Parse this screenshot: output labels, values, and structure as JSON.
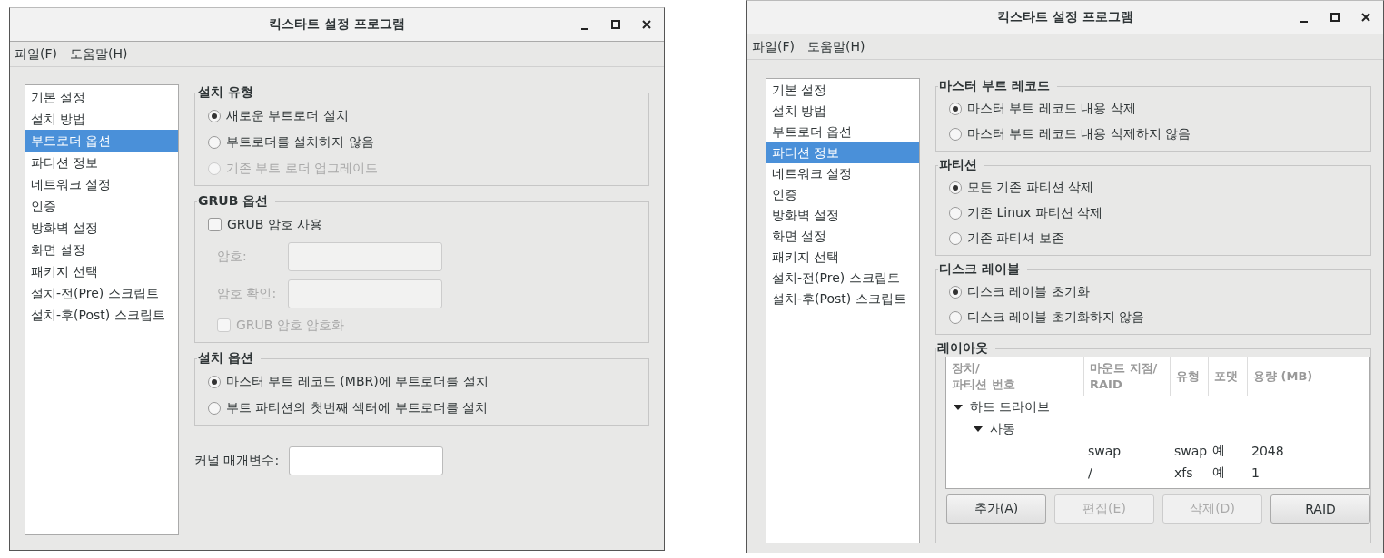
{
  "windows": [
    {
      "title": "킥스타트 설정 프로그램",
      "menu": [
        "파일(F)",
        "도움말(H)"
      ],
      "sidebar": [
        {
          "label": "기본 설정",
          "selected": false
        },
        {
          "label": "설치 방법",
          "selected": false
        },
        {
          "label": "부트로더 옵션",
          "selected": true
        },
        {
          "label": "파티션 정보",
          "selected": false
        },
        {
          "label": "네트워크 설정",
          "selected": false
        },
        {
          "label": "인증",
          "selected": false
        },
        {
          "label": "방화벽 설정",
          "selected": false
        },
        {
          "label": "화면 설정",
          "selected": false
        },
        {
          "label": "패키지 선택",
          "selected": false
        },
        {
          "label": "설치-전(Pre) 스크립트",
          "selected": false
        },
        {
          "label": "설치-후(Post) 스크립트",
          "selected": false
        }
      ],
      "sections": [
        {
          "kind": "group",
          "title": "설치 유형",
          "items": [
            {
              "kind": "radio",
              "label": "새로운 부트로더 설치",
              "selected": true,
              "disabled": false
            },
            {
              "kind": "radio",
              "label": "부트로더를 설치하지 않음",
              "selected": false,
              "disabled": false
            },
            {
              "kind": "radio",
              "label": "기존 부트 로더 업그레이드",
              "selected": false,
              "disabled": true
            }
          ]
        },
        {
          "kind": "group",
          "title": "GRUB 옵션",
          "items": [
            {
              "kind": "checkbox",
              "label": "GRUB 암호 사용",
              "checked": false,
              "disabled": false
            },
            {
              "kind": "field",
              "label": "암호:",
              "disabled": true
            },
            {
              "kind": "field",
              "label": "암호 확인:",
              "disabled": true
            },
            {
              "kind": "checkbox",
              "label": "GRUB 암호 암호화",
              "checked": false,
              "disabled": true
            }
          ]
        },
        {
          "kind": "group",
          "title": "설치 옵션",
          "items": [
            {
              "kind": "radio",
              "label": "마스터 부트 레코드 (MBR)에 부트로더를 설치",
              "selected": true,
              "disabled": false
            },
            {
              "kind": "radio",
              "label": "부트 파티션의 첫번째 섹터에 부트로더를 설치",
              "selected": false,
              "disabled": false
            }
          ]
        },
        {
          "kind": "plain",
          "items": [
            {
              "kind": "field",
              "label": "커널 매개변수:",
              "disabled": false
            }
          ]
        }
      ]
    },
    {
      "title": "킥스타트 설정 프로그램",
      "menu": [
        "파일(F)",
        "도움말(H)"
      ],
      "sidebar": [
        {
          "label": "기본 설정",
          "selected": false
        },
        {
          "label": "설치 방법",
          "selected": false
        },
        {
          "label": "부트로더 옵션",
          "selected": false
        },
        {
          "label": "파티션 정보",
          "selected": true
        },
        {
          "label": "네트워크 설정",
          "selected": false
        },
        {
          "label": "인증",
          "selected": false
        },
        {
          "label": "방화벽 설정",
          "selected": false
        },
        {
          "label": "화면 설정",
          "selected": false
        },
        {
          "label": "패키지 선택",
          "selected": false
        },
        {
          "label": "설치-전(Pre) 스크립트",
          "selected": false
        },
        {
          "label": "설치-후(Post) 스크립트",
          "selected": false
        }
      ],
      "sections": [
        {
          "kind": "group",
          "title": "마스터 부트 레코드",
          "items": [
            {
              "kind": "radio",
              "label": "마스터 부트 레코드 내용 삭제",
              "selected": true,
              "disabled": false
            },
            {
              "kind": "radio",
              "label": "마스터 부트 레코드 내용 삭제하지 않음",
              "selected": false,
              "disabled": false
            }
          ]
        },
        {
          "kind": "group",
          "title": "파티션",
          "items": [
            {
              "kind": "radio",
              "label": "모든 기존 파티션 삭제",
              "selected": true,
              "disabled": false
            },
            {
              "kind": "radio",
              "label": "기존 Linux 파티션 삭제",
              "selected": false,
              "disabled": false
            },
            {
              "kind": "radio",
              "label": "기존 파티셔 보존",
              "selected": false,
              "disabled": false
            }
          ]
        },
        {
          "kind": "group",
          "title": "디스크 레이블",
          "items": [
            {
              "kind": "radio",
              "label": "디스크 레이블 초기화",
              "selected": true,
              "disabled": false
            },
            {
              "kind": "radio",
              "label": "디스크 레이블 초기화하지 않음",
              "selected": false,
              "disabled": false
            }
          ]
        },
        {
          "kind": "table",
          "title": "레이아웃",
          "columns": [
            "장치/\n파티션 번호",
            "마운트 지점/\nRAID",
            "유형",
            "포맷",
            "용량 (MB)"
          ],
          "tree": [
            {
              "label": "하드 드라이브",
              "expanded": true,
              "children": [
                {
                  "label": "사동",
                  "expanded": true,
                  "children": [
                    {
                      "cells": [
                        "swap",
                        "swap",
                        "예",
                        "2048"
                      ]
                    },
                    {
                      "cells": [
                        "/",
                        "xfs",
                        "예",
                        "1"
                      ]
                    }
                  ]
                }
              ]
            }
          ],
          "buttons": [
            {
              "label": "추가(A)",
              "disabled": false
            },
            {
              "label": "편집(E)",
              "disabled": true
            },
            {
              "label": "삭제(D)",
              "disabled": true
            },
            {
              "label": "RAID",
              "disabled": false
            }
          ]
        }
      ]
    }
  ]
}
